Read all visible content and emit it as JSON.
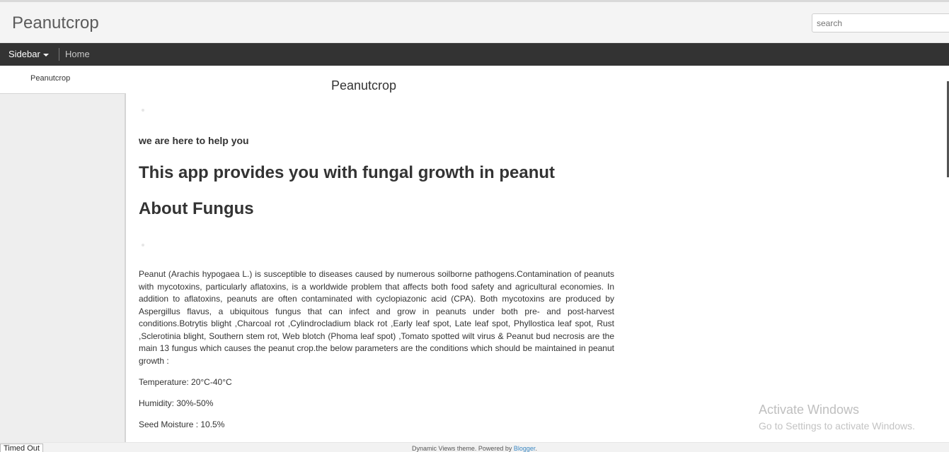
{
  "header": {
    "blog_title": "Peanutcrop",
    "search_placeholder": "search"
  },
  "navbar": {
    "sidebar_label": "Sidebar",
    "home_label": "Home"
  },
  "sidebar": {
    "tab_label": "Peanutcrop"
  },
  "post": {
    "title": "Peanutcrop",
    "subheading": "we are here to help you",
    "heading_app": "This app provides you with fungal growth in peanut",
    "heading_fungus": "About Fungus",
    "paragraph": "Peanut (Arachis hypogaea L.) is susceptible to diseases caused by numerous soilborne pathogens.Contamination of peanuts with mycotoxins, particularly aflatoxins, is a worldwide problem that affects both food safety and agricultural economies. In addition to aflatoxins, peanuts are often contaminated with cyclopiazonic acid (CPA). Both mycotoxins are produced by Aspergillus flavus, a ubiquitous fungus that can infect and grow in peanuts under both pre- and post-harvest conditions.Botrytis blight ,Charcoal rot ,Cylindrocladium black rot ,Early leaf spot, Late leaf spot, Phyllostica leaf spot, Rust ,Sclerotinia blight, Southern stem rot, Web blotch (Phoma leaf spot) ,Tomato spotted wilt virus & Peanut bud necrosis are the main 13 fungus which causes the peanut crop.the below parameters are the conditions which should be maintained in peanut growth :",
    "temperature": "Temperature: 20°C-40°C",
    "humidity": "Humidity: 30%-50%",
    "seed_moisture": "Seed Moisture : 10.5%"
  },
  "watermark": {
    "line1": "Activate Windows",
    "line2": "Go to Settings to activate Windows."
  },
  "footer": {
    "status": "Timed Out",
    "text": "Dynamic Views theme. Powered by ",
    "link": "Blogger",
    "suffix": "."
  }
}
